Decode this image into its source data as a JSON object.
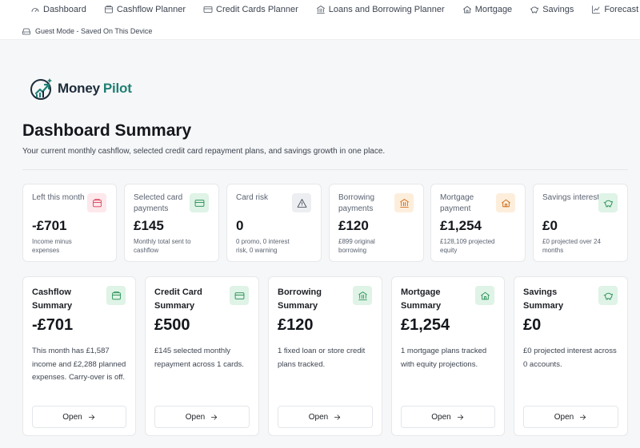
{
  "nav": {
    "items": [
      {
        "label": "Dashboard",
        "icon": "gauge-icon"
      },
      {
        "label": "Cashflow Planner",
        "icon": "wallet-icon"
      },
      {
        "label": "Credit Cards Planner",
        "icon": "credit-card-icon"
      },
      {
        "label": "Loans and Borrowing Planner",
        "icon": "bank-icon"
      },
      {
        "label": "Mortgage",
        "icon": "home-icon"
      },
      {
        "label": "Savings",
        "icon": "piggy-bank-icon"
      },
      {
        "label": "Forecast",
        "icon": "chart-line-icon"
      }
    ],
    "settings_icon": "gear-icon"
  },
  "guest_mode": {
    "label": "Guest Mode - Saved On This Device",
    "icon": "hard-drive-icon"
  },
  "brand": {
    "name_part1": "Money",
    "name_part2": "Pilot",
    "icon": "compass-chart-logo"
  },
  "header": {
    "title": "Dashboard Summary",
    "subtitle": "Your current monthly cashflow, selected credit card repayment plans, and savings growth in one place."
  },
  "stats": [
    {
      "label": "Left this month",
      "value": "-£701",
      "note": "Income minus expenses",
      "icon": "wallet-icon",
      "tint": "red"
    },
    {
      "label": "Selected card payments",
      "value": "£145",
      "note": "Monthly total sent to cashflow",
      "icon": "credit-card-icon",
      "tint": "green"
    },
    {
      "label": "Card risk",
      "value": "0",
      "note": "0 promo, 0 interest risk, 0 warning",
      "icon": "warning-icon",
      "tint": "gray"
    },
    {
      "label": "Borrowing payments",
      "value": "£120",
      "note": "£899 original borrowing",
      "icon": "bank-icon",
      "tint": "orange"
    },
    {
      "label": "Mortgage payment",
      "value": "£1,254",
      "note": "£128,109 projected equity",
      "icon": "home-icon",
      "tint": "orange"
    },
    {
      "label": "Savings interest",
      "value": "£0",
      "note": "£0 projected over 24 months",
      "icon": "piggy-bank-icon",
      "tint": "green"
    }
  ],
  "summaries": [
    {
      "title": "Cashflow Summary",
      "value": "-£701",
      "text": "This month has £1,587 income and £2,288 planned expenses. Carry-over is off.",
      "button": "Open",
      "icon": "wallet-icon"
    },
    {
      "title": "Credit Card Summary",
      "value": "£500",
      "text": "£145 selected monthly repayment across 1 cards.",
      "button": "Open",
      "icon": "credit-card-icon"
    },
    {
      "title": "Borrowing Summary",
      "value": "£120",
      "text": "1 fixed loan or store credit plans tracked.",
      "button": "Open",
      "icon": "bank-icon"
    },
    {
      "title": "Mortgage Summary",
      "value": "£1,254",
      "text": "1 mortgage plans tracked with equity projections.",
      "button": "Open",
      "icon": "home-icon"
    },
    {
      "title": "Savings Summary",
      "value": "£0",
      "text": "£0 projected interest across 0 accounts.",
      "button": "Open",
      "icon": "piggy-bank-icon"
    }
  ],
  "colors": {
    "brand_teal": "#1f7f75",
    "brand_navy": "#1d2b3a",
    "negative_red": "#d83a52",
    "positive_green": "#1f8a4c",
    "warning_orange": "#c8620a"
  }
}
